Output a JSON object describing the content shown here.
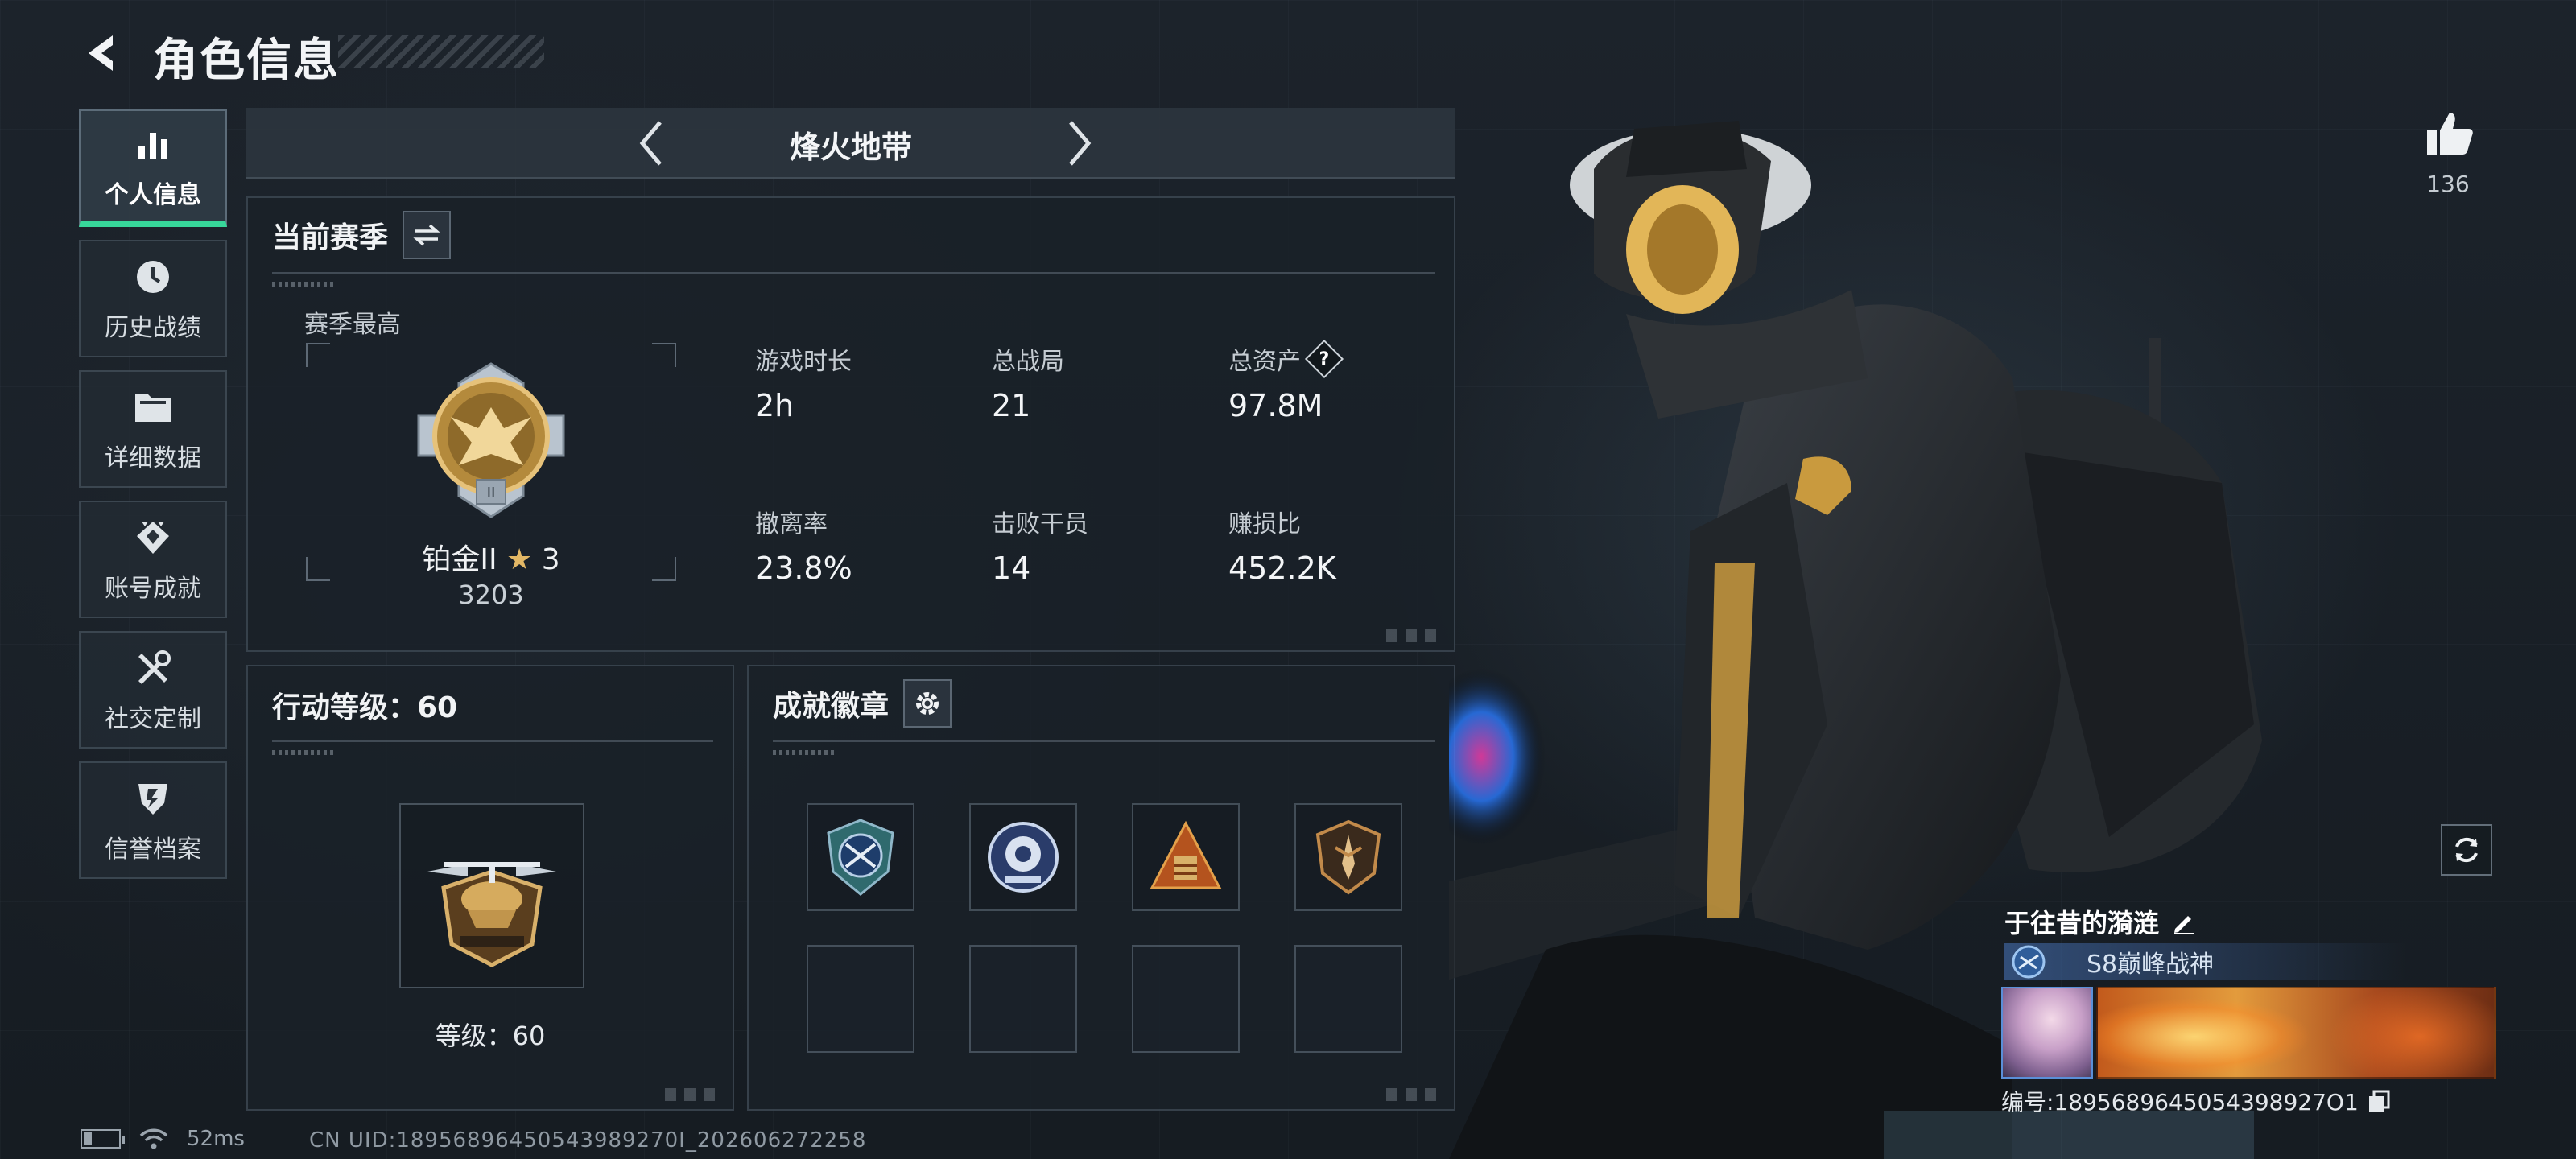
{
  "header": {
    "title": "角色信息"
  },
  "nav": {
    "items": [
      {
        "label": "个人信息",
        "icon": "bar-chart-icon",
        "active": true
      },
      {
        "label": "历史战绩",
        "icon": "clock-icon",
        "active": false
      },
      {
        "label": "详细数据",
        "icon": "folder-icon",
        "active": false
      },
      {
        "label": "账号成就",
        "icon": "achievement-icon",
        "active": false
      },
      {
        "label": "社交定制",
        "icon": "tools-icon",
        "active": false
      },
      {
        "label": "信誉档案",
        "icon": "shield-icon",
        "active": false
      }
    ]
  },
  "mode": {
    "title": "烽火地带"
  },
  "season": {
    "title": "当前赛季",
    "best_label": "赛季最高",
    "rank_tier": "铂金II",
    "rank_star_glyph": "★",
    "rank_stars": "3",
    "rank_score": "3203",
    "stats": [
      {
        "label": "游戏时长",
        "value": "2h"
      },
      {
        "label": "总战局",
        "value": "21"
      },
      {
        "label": "总资产",
        "value": "97.8M",
        "help": "?"
      },
      {
        "label": "撤离率",
        "value": "23.8%"
      },
      {
        "label": "击败干员",
        "value": "14"
      },
      {
        "label": "赚损比",
        "value": "452.2K"
      }
    ]
  },
  "level": {
    "title": "行动等级：60",
    "text": "等级：60"
  },
  "badges": {
    "title": "成就徽章",
    "filled_count": 4,
    "empty_count": 4
  },
  "profile": {
    "like_count": "136",
    "player_name": "于往昔的漪涟",
    "title": "S8巅峰战神",
    "id_text": "编号:1895689645054398927O1"
  },
  "status": {
    "ping": "52ms",
    "uid": "CN UID:18956896450543989270I_202606272258"
  },
  "colors": {
    "accent_green": "#37d79a",
    "gold": "#e2b765",
    "panel_border": "#6e7d8c"
  }
}
